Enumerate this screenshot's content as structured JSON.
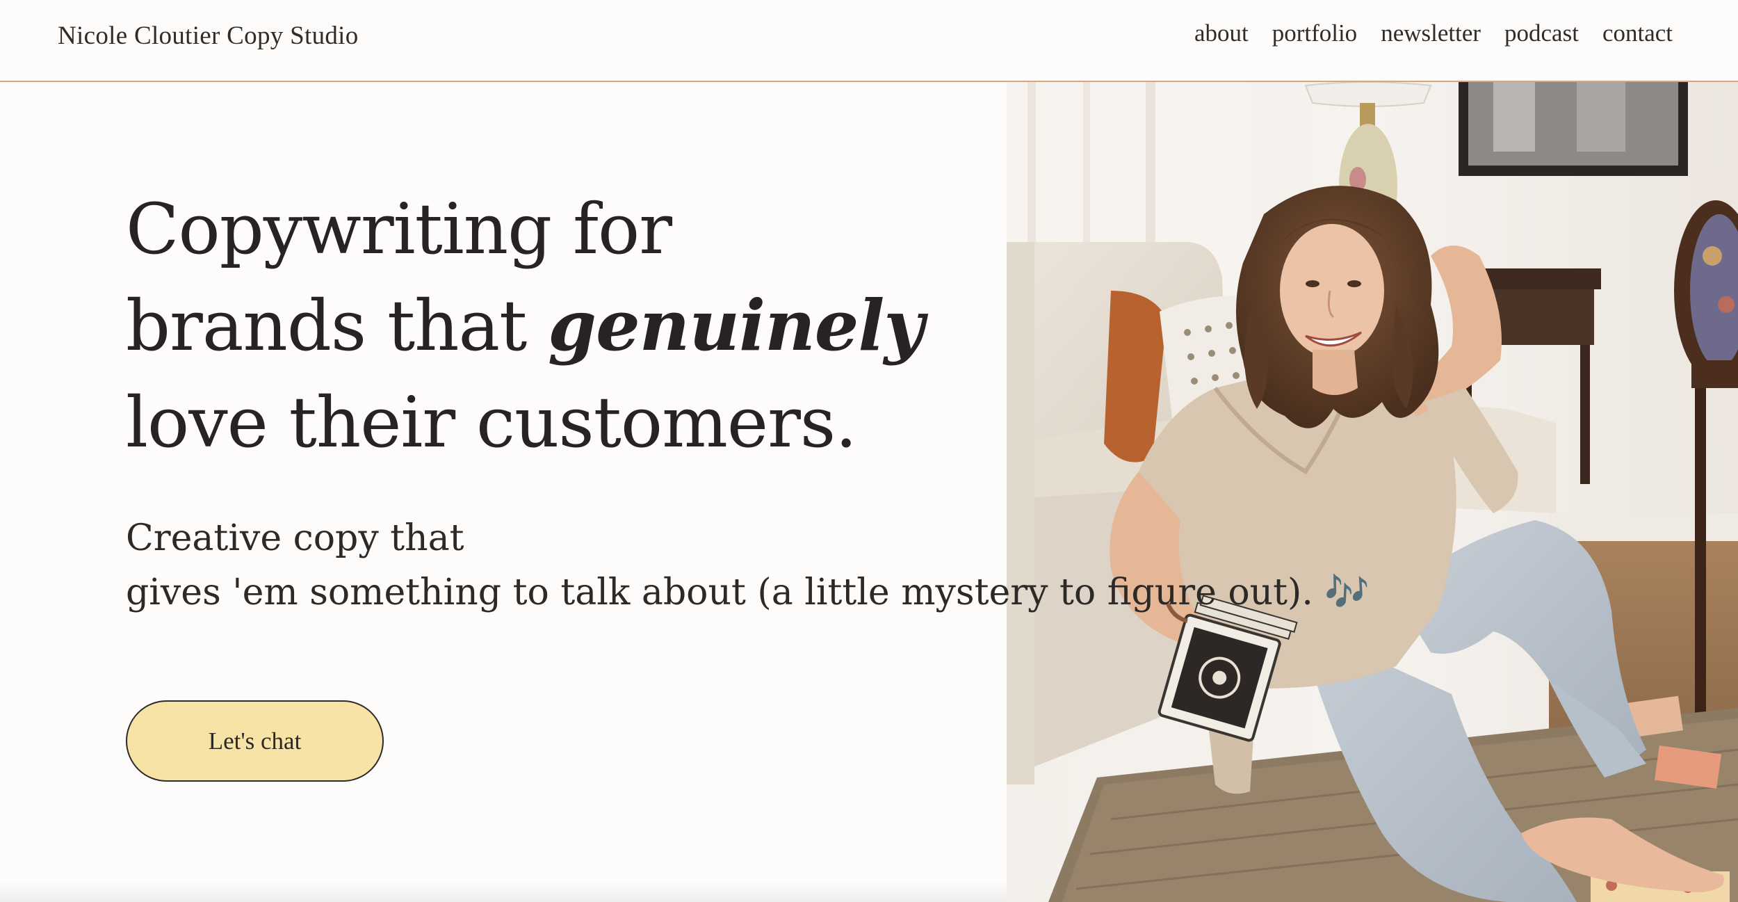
{
  "header": {
    "site_title": "Nicole Cloutier Copy Studio",
    "nav": [
      {
        "label": "about"
      },
      {
        "label": "portfolio"
      },
      {
        "label": "newsletter"
      },
      {
        "label": "podcast"
      },
      {
        "label": "contact"
      }
    ]
  },
  "hero": {
    "headline": {
      "line1": "Copywriting for",
      "line2_start": "brands that ",
      "line2_emphasis": "genuinely",
      "line3": "love their customers."
    },
    "subline": {
      "line1": "Creative copy that",
      "line2": "gives 'em something to talk about (a little mystery to figure out). 🎶"
    },
    "cta_label": "Let's chat",
    "photo": {
      "subject": "woman-sitting-on-floor-holding-tarot-cards"
    }
  },
  "colors": {
    "background": "#fdfcfb",
    "header_border": "#d6a584",
    "cta_fill": "#f7e3a6",
    "text": "#2a2725"
  }
}
